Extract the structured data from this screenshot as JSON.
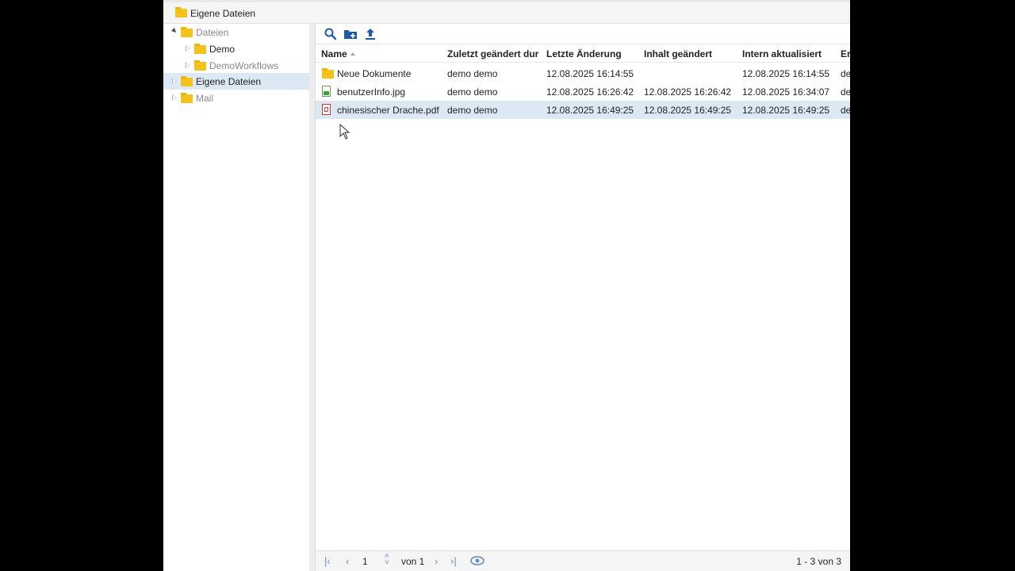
{
  "window": {
    "title": "Eigene Dateien"
  },
  "tree": [
    {
      "label": "Dateien",
      "state": "open",
      "dim": true
    },
    {
      "label": "Demo",
      "state": "closed",
      "dim": false
    },
    {
      "label": "DemoWorkflows",
      "state": "closed",
      "dim": true
    },
    {
      "label": "Eigene Dateien",
      "state": "closed",
      "dim": false,
      "selected": true
    },
    {
      "label": "Mail",
      "state": "closed",
      "dim": true
    }
  ],
  "toolbar": {
    "search_icon": "search-icon",
    "new_folder_icon": "new-folder-icon",
    "upload_icon": "upload-icon"
  },
  "grid": {
    "columns": [
      "Name",
      "Zuletzt geändert dur",
      "Letzte Änderung",
      "Inhalt geändert",
      "Intern aktualisiert",
      "Ers"
    ],
    "rows": [
      {
        "type": "folder",
        "name": "Neue Dokumente",
        "changed_by": "demo demo",
        "last_change": "12.08.2025 16:14:55",
        "content_changed": "",
        "internal_updated": "12.08.2025 16:14:55",
        "created": "dem"
      },
      {
        "type": "image",
        "name": "benutzerInfo.jpg",
        "changed_by": "demo demo",
        "last_change": "12.08.2025 16:26:42",
        "content_changed": "12.08.2025 16:26:42",
        "internal_updated": "12.08.2025 16:34:07",
        "created": "dem"
      },
      {
        "type": "pdf",
        "name": "chinesischer Drache.pdf",
        "changed_by": "demo demo",
        "last_change": "12.08.2025 16:49:25",
        "content_changed": "12.08.2025 16:49:25",
        "internal_updated": "12.08.2025 16:49:25",
        "created": "dem"
      }
    ]
  },
  "pager": {
    "page": "1",
    "of_label": "von 1",
    "summary": "1 - 3 von 3"
  },
  "colors": {
    "accent": "#2b5fa8",
    "selection": "#dde8f5",
    "folder": "#f5c21b"
  }
}
